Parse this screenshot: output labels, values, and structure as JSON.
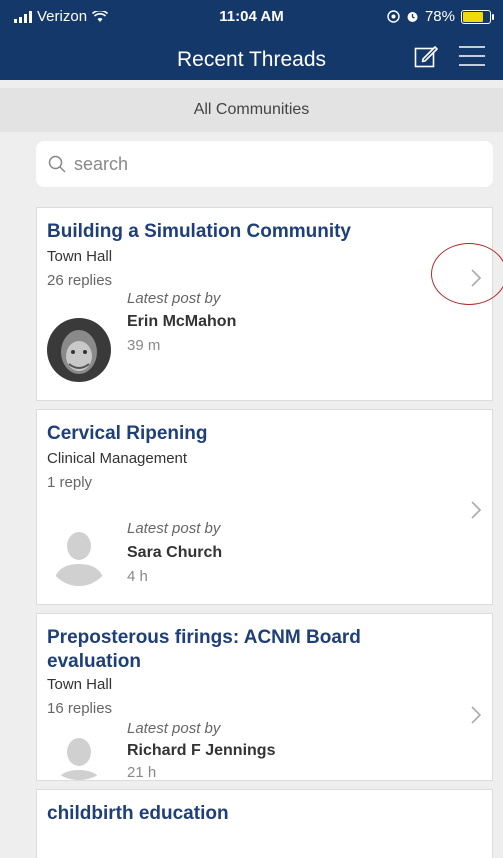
{
  "status_bar": {
    "carrier": "Verizon",
    "time": "11:04 AM",
    "battery_percent": "78%",
    "battery_level": 0.78
  },
  "header": {
    "title": "Recent Threads"
  },
  "community_filter": {
    "label": "All Communities"
  },
  "search": {
    "placeholder": "search"
  },
  "threads": [
    {
      "title": "Building a Simulation Community",
      "community": "Town Hall",
      "replies": "26 replies",
      "latest_label": "Latest post by",
      "author": "Erin McMahon",
      "time": "39 m"
    },
    {
      "title": "Cervical Ripening",
      "community": "Clinical Management",
      "replies": "1 reply",
      "latest_label": "Latest post by",
      "author": "Sara Church",
      "time": "4 h"
    },
    {
      "title": "Preposterous firings: ACNM Board evaluation",
      "community": "Town Hall",
      "replies": "16 replies",
      "latest_label": "Latest post by",
      "author": "Richard F Jennings",
      "time": "21 h"
    },
    {
      "title": "childbirth education"
    }
  ],
  "colors": {
    "header_bg": "#14386a",
    "title_blue": "#1f3f78",
    "battery": "#f5d80a",
    "highlight": "#b22a2a"
  },
  "icons": [
    "signal-icon",
    "wifi-icon",
    "location-icon",
    "alarm-icon",
    "battery-icon",
    "compose-icon",
    "menu-icon",
    "search-icon",
    "chevron-right-icon",
    "avatar-placeholder-icon"
  ]
}
